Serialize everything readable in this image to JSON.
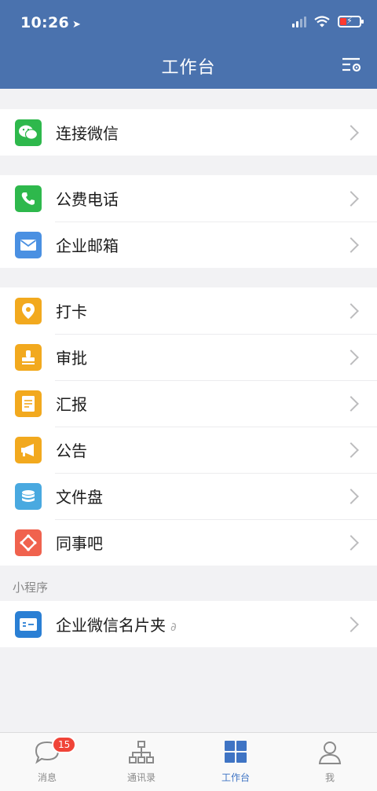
{
  "status": {
    "time": "10:26"
  },
  "header": {
    "title": "工作台"
  },
  "groups": [
    {
      "items": [
        {
          "label": "连接微信",
          "icon": "wechat-icon",
          "color": "#2eb84c"
        }
      ]
    },
    {
      "items": [
        {
          "label": "公费电话",
          "icon": "phone-icon",
          "color": "#2eb84c"
        },
        {
          "label": "企业邮箱",
          "icon": "mail-icon",
          "color": "#4a90e2"
        }
      ]
    },
    {
      "items": [
        {
          "label": "打卡",
          "icon": "location-pin-icon",
          "color": "#f2a91e"
        },
        {
          "label": "审批",
          "icon": "stamp-icon",
          "color": "#f2a91e"
        },
        {
          "label": "汇报",
          "icon": "report-icon",
          "color": "#f2a91e"
        },
        {
          "label": "公告",
          "icon": "megaphone-icon",
          "color": "#f2a91e"
        },
        {
          "label": "文件盘",
          "icon": "disk-icon",
          "color": "#49a9e0"
        },
        {
          "label": "同事吧",
          "icon": "colleague-icon",
          "color": "#f0624e"
        }
      ]
    }
  ],
  "mini_programs": {
    "section_label": "小程序",
    "items": [
      {
        "label": "企业微信名片夹",
        "icon": "card-holder-icon",
        "color": "#2a7fd4"
      }
    ]
  },
  "tabbar": [
    {
      "label": "消息",
      "icon": "message-icon",
      "badge": "15",
      "active": false
    },
    {
      "label": "通讯录",
      "icon": "contacts-icon",
      "active": false
    },
    {
      "label": "工作台",
      "icon": "workbench-icon",
      "active": true
    },
    {
      "label": "我",
      "icon": "me-icon",
      "active": false
    }
  ]
}
